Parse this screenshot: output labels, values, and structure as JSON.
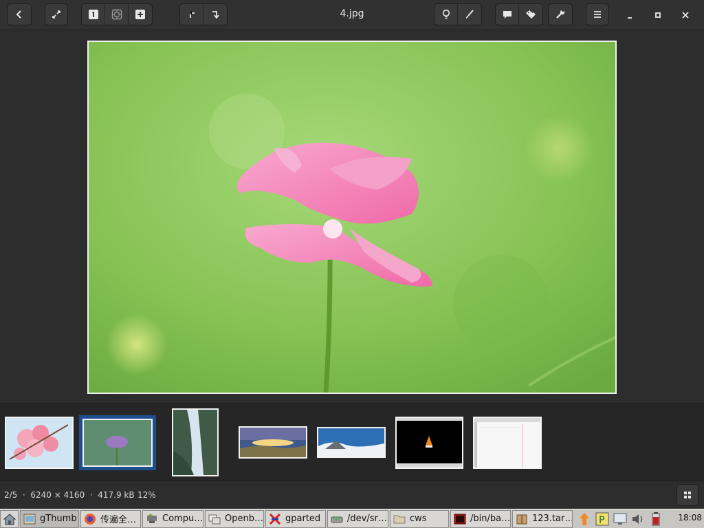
{
  "header": {
    "title": "4.jpg",
    "buttons": {
      "back": "back-icon",
      "fullscreen": "fullscreen-icon",
      "zoom_actual": "actual-size-icon",
      "zoom_fit": "fit-icon",
      "zoom_in": "zoom-in-icon",
      "rotate_left": "rotate-left-icon",
      "rotate_right": "rotate-right-icon",
      "adjust": "lightbulb-icon",
      "edit": "brush-icon",
      "comment": "comment-icon",
      "tags": "tags-icon",
      "tools": "wrench-icon",
      "menu": "hamburger-icon"
    }
  },
  "thumbnails": [
    {
      "name": "cherry-blossom",
      "selected": false
    },
    {
      "name": "purple-flower",
      "selected": true
    },
    {
      "name": "waterfall",
      "selected": false
    },
    {
      "name": "sunset-landscape",
      "selected": false
    },
    {
      "name": "mountain-clouds",
      "selected": false
    },
    {
      "name": "vlc-screenshot",
      "selected": false
    },
    {
      "name": "document-screenshot",
      "selected": false
    }
  ],
  "status": {
    "info": "2/5  ·  6240 × 4160  ·  417.9 kB",
    "zoom": "12%"
  },
  "taskbar": {
    "tasks": [
      {
        "label": "gThumb",
        "active": true
      },
      {
        "label": "传遍全…",
        "active": false
      },
      {
        "label": "Compu…",
        "active": false
      },
      {
        "label": "Openb…",
        "active": false
      },
      {
        "label": "gparted",
        "active": false
      },
      {
        "label": "/dev/sr…",
        "active": false
      },
      {
        "label": "cws",
        "active": false
      },
      {
        "label": "/bin/ba…",
        "active": false
      },
      {
        "label": "123.tar…",
        "active": false
      }
    ],
    "clock": "18:08"
  },
  "colors": {
    "accent": "#1f4e8f",
    "header_bg": "#313131",
    "taskbar_bg": "#c8c6c2"
  }
}
